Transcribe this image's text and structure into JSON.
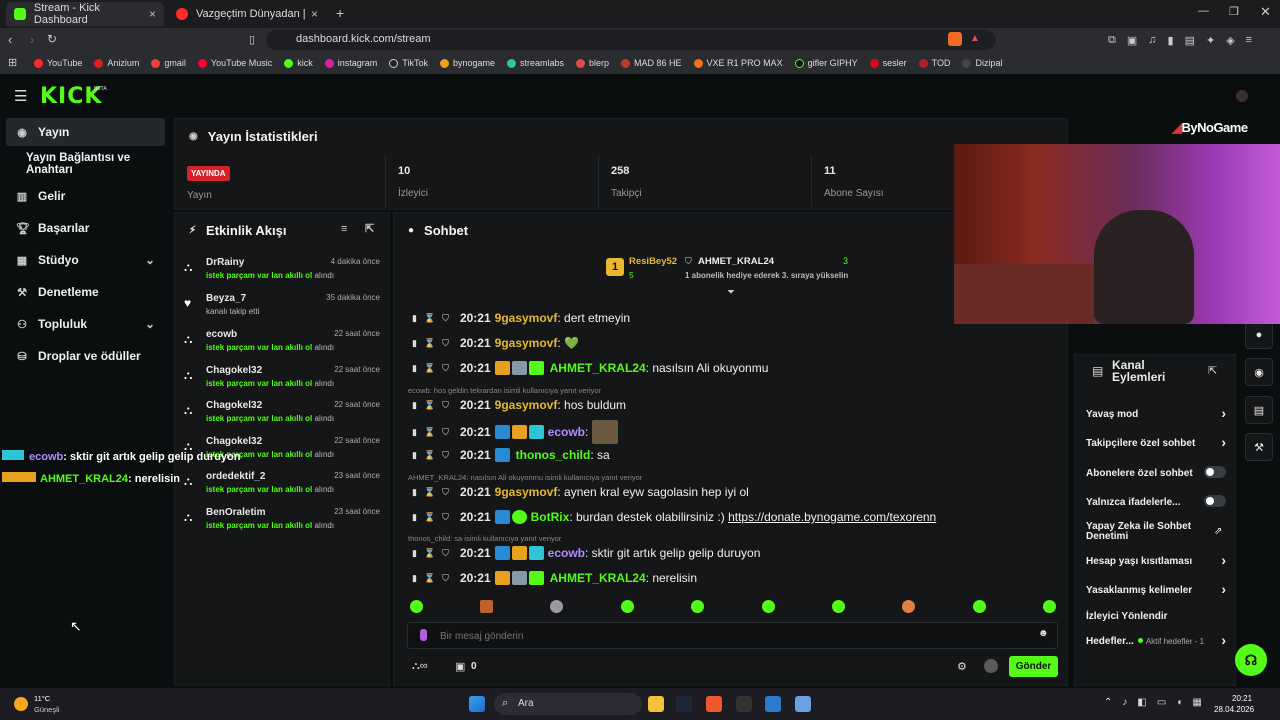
{
  "browser": {
    "tabs": [
      {
        "title": "Stream - Kick Dashboard",
        "close": "×"
      },
      {
        "title": "Vazgeçtim Dünyadan | YouTube M",
        "close": "×"
      }
    ],
    "new_tab": "+",
    "url": "dashboard.kick.com/stream",
    "bookmarks": [
      "YouTube",
      "Anizium",
      "gmail",
      "YouTube Music",
      "kick",
      "instagram",
      "TikTok",
      "bynogame",
      "streamlabs",
      "blerp",
      "MAD 86 HE",
      "VXE R1 PRO MAX",
      "gifler GIPHY",
      "sesler",
      "TOD",
      "Dizipal"
    ]
  },
  "app": {
    "logo": "KICK",
    "logo_sup": "BETA",
    "sidebar": [
      {
        "label": "Yayın",
        "icon": "broadcast-icon"
      },
      {
        "label": "Yayın Bağlantısı ve Anahtarı",
        "icon": ""
      },
      {
        "label": "Gelir",
        "icon": "chart-icon"
      },
      {
        "label": "Başarılar",
        "icon": "trophy-icon"
      },
      {
        "label": "Stüdyo",
        "icon": "grid-icon",
        "chev": "⌄"
      },
      {
        "label": "Denetleme",
        "icon": "wrench-icon"
      },
      {
        "label": "Topluluk",
        "icon": "people-icon",
        "chev": "⌄"
      },
      {
        "label": "Droplar ve ödüller",
        "icon": "drops-icon"
      }
    ],
    "stats": {
      "title": "Yayın İstatistikleri",
      "live_badge": "YAYINDA",
      "live_label": "Yayın",
      "items": [
        {
          "value": "10",
          "label": "İzleyici"
        },
        {
          "value": "258",
          "label": "Takipçi"
        },
        {
          "value": "11",
          "label": "Abone Sayısı"
        }
      ]
    },
    "activity": {
      "title": "Etkinlik Akışı",
      "items": [
        {
          "name": "DrRainy",
          "time": "4 dakika önce",
          "desc_hl": "istek parçam var lan akıllı ol",
          "desc": " alındı"
        },
        {
          "name": "Beyza_7",
          "time": "35 dakika önce",
          "desc_hl": "",
          "desc": "kanalı takip etti"
        },
        {
          "name": "ecowb",
          "time": "22 saat önce",
          "desc_hl": "istek parçam var lan akıllı ol",
          "desc": " alındı"
        },
        {
          "name": "Chagokel32",
          "time": "22 saat önce",
          "desc_hl": "istek parçam var lan akıllı ol",
          "desc": " alındı"
        },
        {
          "name": "Chagokel32",
          "time": "22 saat önce",
          "desc_hl": "istek parçam var lan akıllı ol",
          "desc": " alındı"
        },
        {
          "name": "Chagokel32",
          "time": "22 saat önce",
          "desc_hl": "istek parçam var lan akıllı ol",
          "desc": " alındı"
        },
        {
          "name": "ordedektif_2",
          "time": "23 saat önce",
          "desc_hl": "istek parçam var lan akıllı ol",
          "desc": " alındı"
        },
        {
          "name": "BenOraletim",
          "time": "23 saat önce",
          "desc_hl": "istek parçam var lan akıllı ol",
          "desc": " alındı"
        }
      ]
    },
    "chat": {
      "title": "Sohbet",
      "pinned": {
        "rank1_name": "ResiBey52",
        "rank1_count": "5",
        "rank2_name": "AHMET_KRAL24",
        "rank2_count": "3",
        "rank2_desc": "1 abonelik hediye ederek 3. sıraya yükselin"
      },
      "messages": [
        {
          "time": "20:21",
          "user": "9gasymovf",
          "color": "#e8b830",
          "text": "dert etmeyin"
        },
        {
          "time": "20:21",
          "user": "9gasymovf",
          "color": "#e8b830",
          "text": "💚"
        },
        {
          "time": "20:21",
          "user": "AHMET_KRAL24",
          "color": "#53fc18",
          "text": "nasılsın Ali okuyonmu"
        },
        {
          "time": "20:21",
          "user": "9gasymovf",
          "color": "#e8b830",
          "text": "hos buldum"
        },
        {
          "time": "20:21",
          "user": "ecowb",
          "color": "#b78cff",
          "text": ""
        },
        {
          "time": "20:21",
          "user": "thonos_child",
          "color": "#53fc18",
          "text": "sa"
        },
        {
          "time": "20:21",
          "user": "9gasymovf",
          "color": "#e8b830",
          "text": "aynen kral eyw sagolasin hep iyi ol"
        },
        {
          "time": "20:21",
          "user": "BotRix",
          "color": "#53fc18",
          "text": "burdan destek olabilirsiniz :)",
          "link": "https://donate.bynogame.com/texorenn"
        },
        {
          "time": "20:21",
          "user": "ecowb",
          "color": "#b78cff",
          "text": "sktir git artık gelip gelip duruyon"
        },
        {
          "time": "20:21",
          "user": "AHMET_KRAL24",
          "color": "#53fc18",
          "text": "nerelisin"
        }
      ],
      "replies": [
        "ecowb: hos geldin tekrardan isimli kullanıcıya yanıt veriyor",
        "AHMET_KRAL24: nasılsın Ali okuyonmu isimli kullanıcıya yanıt veriyor",
        "thonos_child: sa isimli kullanıcıya yanıt veriyor"
      ],
      "input_placeholder": "Bir mesaj gönderin",
      "sub_count": "0",
      "send_label": "Gönder"
    },
    "channel_actions": {
      "title": "Kanal Eylemleri",
      "items": [
        {
          "label": "Yavaş mod",
          "control": "chevron"
        },
        {
          "label": "Takipçilere özel sohbet",
          "control": "chevron"
        },
        {
          "label": "Abonelere özel sohbet",
          "control": "toggle"
        },
        {
          "label": "Yalnızca ifadelerle...",
          "control": "toggle"
        },
        {
          "label": "Yapay Zeka ile Sohbet Denetimi",
          "control": "external"
        },
        {
          "label": "Hesap yaşı kısıtlaması",
          "control": "chevron"
        },
        {
          "label": "Yasaklanmış kelimeler",
          "control": "chevron"
        },
        {
          "label": "İzleyici Yönlendir",
          "control": "none"
        },
        {
          "label": "Hedefler...",
          "control": "chevron",
          "extra": "Aktif hedefler - 1"
        }
      ]
    },
    "overlay": {
      "brand": "ByNoGame",
      "chat": [
        {
          "user": "ecowb",
          "text": ": sktir git artık gelip gelip duruyon"
        },
        {
          "user": "AHMET_KRAL24",
          "text": ": nerelisin"
        }
      ]
    }
  },
  "taskbar": {
    "weather_temp": "11°C",
    "weather_desc": "Güneşli",
    "search": "Ara",
    "time": "20:21",
    "date": "28.04.2026"
  }
}
